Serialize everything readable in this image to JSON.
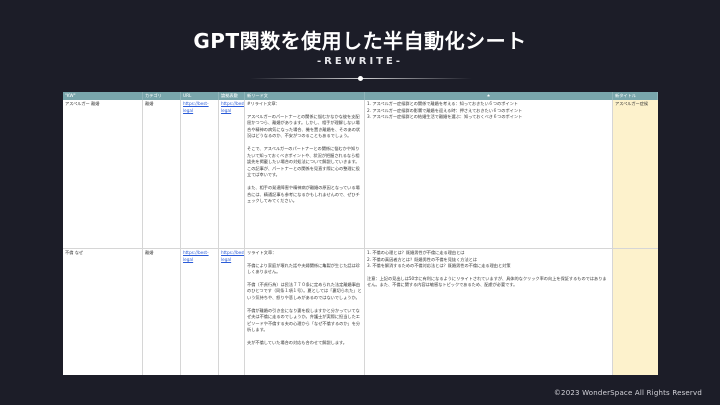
{
  "header": {
    "title": "GPT関数を使用した半自動化シート",
    "subtitle": "-REWRITE-"
  },
  "sheet": {
    "columns": [
      "\"KW\"",
      "カテゴリ",
      "URL",
      "論拠表敷",
      "新リード文",
      "★",
      "新タイトル"
    ],
    "rows": [
      {
        "kw": "アスペルガー 離婚",
        "category": "離婚",
        "url": "https://best-legal",
        "url2": "https://best-legal",
        "lead_paragraphs": [
          "#リライト文章：",
          "アスペルガーのパートナーとの関係に悩むかなかな彼を支配屈かつつら、離婚があります。しかし、相手が理解しない場合や精神の病気になった場合、機を置き離婚を、そのあの状況はどうなるのか、不安がつのることもあるでしょう。",
          "そこで、アスペルガーのパートナーとの関係に悩むかや知りたいて知っておくべきポイントや、状況が把握されるなら相談先を掲載したい場合の対処法について解説していきます。この記事が、パートナーとの関係を見直す際に心の整理に役立てば幸いです。",
          "また、相手の発達障害や精神病が離婚の原因となっている場合には、精通記事も参考になるかもしれませんので、ぜひチェックしてみてください。"
        ],
        "star": [
          "1. アスペルガー症候群との関係で離婚を考える：知っておきたい６つのポイント",
          "2. アスペルガー症候群の影響で離婚を迎える時：押さえておきたい６つのポイント",
          "3. アスペルガー症候群との結婚生活で離婚を選ぶ：知っておくべき６つのポイント"
        ],
        "new_title": "アスペルガー症候"
      },
      {
        "kw": "不倫 なぜ",
        "category": "離婚",
        "url": "https://best-legal",
        "url2": "https://best-legal",
        "lead_paragraphs": [
          "リライト文章：",
          "不倫により家庭が壊れた話や夫婦関係に亀裂が生じた話は珍しくありません。",
          "不倫（不貞行為）は民法７７０条に定められた法定離婚事由のひとつです（同条１項１号）。夏としては「裏切られた」という気持ちや、怒りや悲しみがあるのではないでしょうか。",
          "不倫が離婚の引き金になり妻を殺しますかと分かっていてなぜ夫は不倫に走るのでしょうか。弁護士が実際に担当したエピソードや不倫する夫の心理から「なぜ不倫するのか」を分析します。",
          "夫が不倫していた場合の対応も合わせて解説します。"
        ],
        "star": [
          "1. 不倫の心理とは？既婚男性が不倫に走る理由とは",
          "2. 不倫の真因者方とは？既婚男性の不倫を見抜く方法とは",
          "3. 不倫を解消するための不倫対応法とは？既婚男性の不倫に走る理由と対策",
          "注意：上記の見出しは50字に有利になるようにリライトされていますが、具体的なクリック率の向上を保証するものではありません。また、不倫に関する内容は敏感なトピックであるため、配慮が必要です。"
        ],
        "new_title": ""
      }
    ]
  },
  "footer": {
    "copyright": "©2023 WonderSpace All Rights Reservd"
  }
}
